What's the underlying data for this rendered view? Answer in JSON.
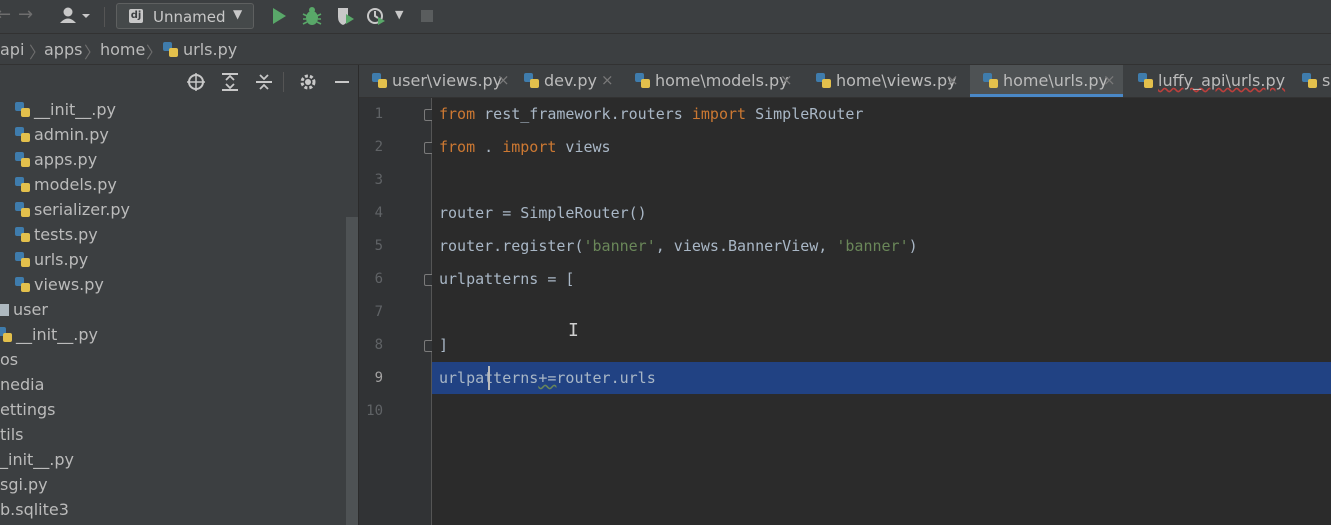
{
  "toolbar": {
    "run_config_label": "Unnamed",
    "back_icon": "back-arrow-icon",
    "forward_icon": "forward-arrow-icon",
    "colors": {
      "run": "#59a869",
      "debug": "#59a869",
      "stop": "#5a5d5e"
    }
  },
  "breadcrumb": [
    "api",
    "apps",
    "home",
    "urls.py"
  ],
  "project_tree": {
    "items": [
      {
        "label": "__init__.py",
        "kind": "py"
      },
      {
        "label": "admin.py",
        "kind": "py"
      },
      {
        "label": "apps.py",
        "kind": "py"
      },
      {
        "label": "models.py",
        "kind": "py"
      },
      {
        "label": "serializer.py",
        "kind": "py"
      },
      {
        "label": "tests.py",
        "kind": "py"
      },
      {
        "label": "urls.py",
        "kind": "py"
      },
      {
        "label": "views.py",
        "kind": "py"
      },
      {
        "label": "user",
        "kind": "folder"
      },
      {
        "label": "__init__.py",
        "kind": "py"
      },
      {
        "label": "os",
        "kind": "text"
      },
      {
        "label": "nedia",
        "kind": "text"
      },
      {
        "label": "ettings",
        "kind": "text"
      },
      {
        "label": "tils",
        "kind": "text"
      },
      {
        "label": "_init__.py",
        "kind": "text"
      },
      {
        "label": "sgi.py",
        "kind": "text"
      },
      {
        "label": "b.sqlite3",
        "kind": "text"
      }
    ]
  },
  "tabs": [
    {
      "label": "user\\views.py",
      "active": false
    },
    {
      "label": "dev.py",
      "active": false
    },
    {
      "label": "home\\models.py",
      "active": false
    },
    {
      "label": "home\\views.py",
      "active": false
    },
    {
      "label": "home\\urls.py",
      "active": true
    },
    {
      "label": "luffy_api\\urls.py",
      "active": false
    },
    {
      "label": "s",
      "active": false
    }
  ],
  "editor": {
    "line_numbers": [
      "1",
      "2",
      "3",
      "4",
      "5",
      "6",
      "7",
      "8",
      "9",
      "10"
    ],
    "current_line": "9",
    "code": {
      "l1_kw1": "from",
      "l1_mod": " rest_framework.routers ",
      "l1_kw2": "import",
      "l1_name": " SimpleRouter",
      "l2_kw1": "from",
      "l2_mid": " . ",
      "l2_kw2": "import",
      "l2_name": " views",
      "l4": "router = SimpleRouter()",
      "l5_a": "router.register(",
      "l5_s1": "'banner'",
      "l5_b": ", views.BannerView, ",
      "l5_s2": "'banner'",
      "l5_c": ")",
      "l6": "urlpatterns = [",
      "l8": "]",
      "l9_a": "urlpa",
      "l9_b": "tterns",
      "l9_op": "+=",
      "l9_c": "router.urls"
    }
  }
}
